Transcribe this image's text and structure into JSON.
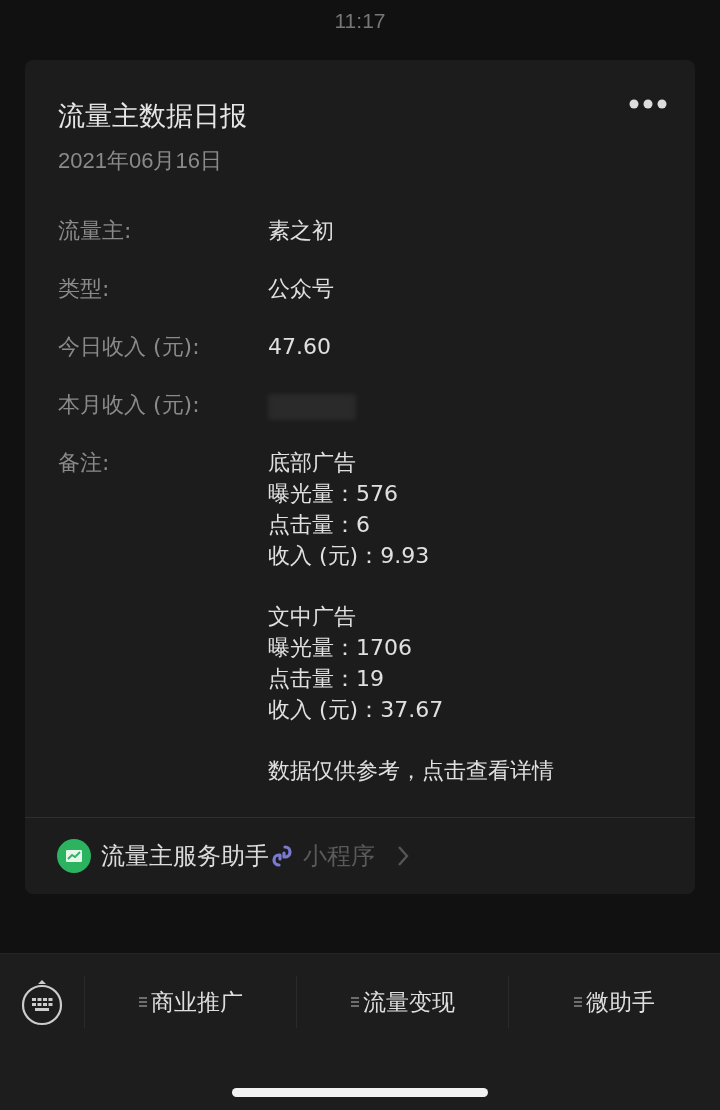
{
  "status_bar": {
    "time": "11:17"
  },
  "card": {
    "title": "流量主数据日报",
    "date": "2021年06月16日",
    "fields": [
      {
        "label": "流量主:",
        "value": "素之初",
        "kind": "text"
      },
      {
        "label": "类型:",
        "value": "公众号",
        "kind": "text"
      },
      {
        "label": "今日收入 (元):",
        "value": "47.60",
        "kind": "text"
      },
      {
        "label": "本月收入 (元):",
        "kind": "redacted"
      },
      {
        "label": "备注:",
        "kind": "notes",
        "groups": [
          [
            "底部广告",
            "曝光量：576",
            "点击量：6",
            "收入 (元)：9.93"
          ],
          [
            "文中广告",
            "曝光量：1706",
            "点击量：19",
            "收入 (元)：37.67"
          ],
          [
            "数据仅供参考，点击查看详情"
          ]
        ]
      }
    ],
    "footer": {
      "name": "流量主服务助手",
      "tag": "小程序"
    }
  },
  "menu": {
    "items": [
      "商业推广",
      "流量变现",
      "微助手"
    ]
  }
}
